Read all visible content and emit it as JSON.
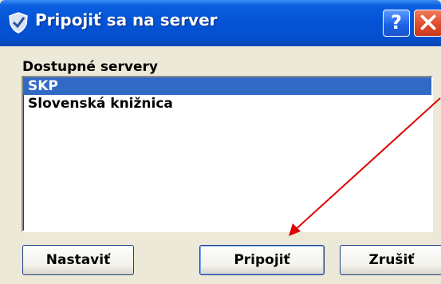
{
  "window": {
    "title": "Pripojiť sa na server",
    "help_label": "?",
    "close_label": "✕"
  },
  "servers": {
    "label": "Dostupné servery",
    "items": [
      {
        "label": "SKP",
        "selected": true
      },
      {
        "label": "Slovenská knižnica",
        "selected": false
      }
    ]
  },
  "buttons": {
    "settings_label": "Nastaviť",
    "connect_label": "Pripojiť",
    "cancel_label": "Zrušiť"
  },
  "colors": {
    "selection": "#316ac5",
    "annotation_arrow": "#e00000",
    "titlebar": "#0553d6"
  },
  "icons": {
    "app": "connect-shield-icon",
    "help": "question-mark-icon",
    "close": "close-icon"
  }
}
